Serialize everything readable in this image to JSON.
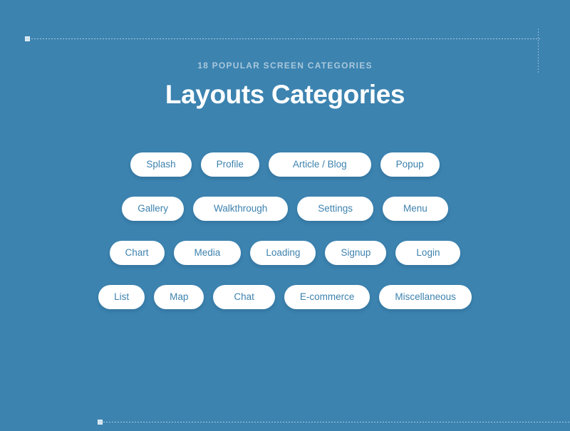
{
  "theme": {
    "background": "#3c83b0",
    "pill_background": "#ffffff",
    "pill_text": "#3d82ae",
    "title_color": "#ffffff",
    "eyebrow_color": "#a9c8dc",
    "guide_color": "#d6e8f3"
  },
  "header": {
    "eyebrow": "18 POPULAR SCREEN CATEGORIES",
    "title": "Layouts Categories"
  },
  "categories": {
    "rows": [
      [
        {
          "label": "Splash"
        },
        {
          "label": "Profile"
        },
        {
          "label": "Article / Blog"
        },
        {
          "label": "Popup"
        }
      ],
      [
        {
          "label": "Gallery"
        },
        {
          "label": "Walkthrough"
        },
        {
          "label": "Settings"
        },
        {
          "label": "Menu"
        }
      ],
      [
        {
          "label": "Chart"
        },
        {
          "label": "Media"
        },
        {
          "label": "Loading"
        },
        {
          "label": "Signup"
        },
        {
          "label": "Login"
        }
      ],
      [
        {
          "label": "List"
        },
        {
          "label": "Map"
        },
        {
          "label": "Chat"
        },
        {
          "label": "E-commerce"
        },
        {
          "label": "Miscellaneous"
        }
      ]
    ]
  }
}
